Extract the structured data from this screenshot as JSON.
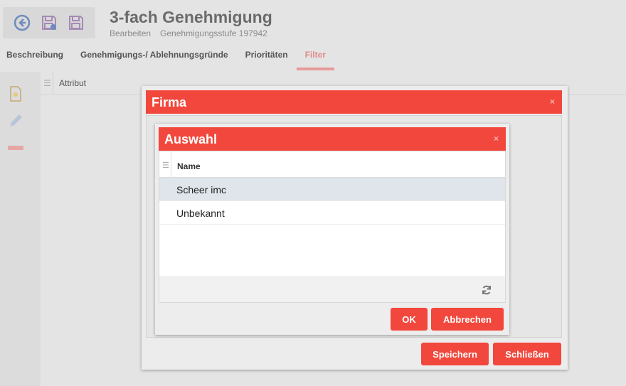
{
  "header": {
    "title": "3-fach Genehmigung",
    "mode": "Bearbeiten",
    "subtitle": "Genehmigungsstufe 197942"
  },
  "tabs": [
    {
      "label": "Beschreibung"
    },
    {
      "label": "Genehmigungs-/ Ablehnungsgründe"
    },
    {
      "label": "Prioritäten"
    },
    {
      "label": "Filter",
      "active": true
    }
  ],
  "grid": {
    "column": "Attribut"
  },
  "firma_dialog": {
    "title": "Firma",
    "close": "×",
    "save_label": "Speichern",
    "close_label": "Schließen"
  },
  "auswahl_dialog": {
    "title": "Auswahl",
    "close": "×",
    "column": "Name",
    "rows": [
      "Scheer imc",
      "Unbekannt"
    ],
    "ok_label": "OK",
    "cancel_label": "Abbrechen"
  },
  "colors": {
    "accent": "#f2473c",
    "tab_active": "#e08a8a"
  }
}
